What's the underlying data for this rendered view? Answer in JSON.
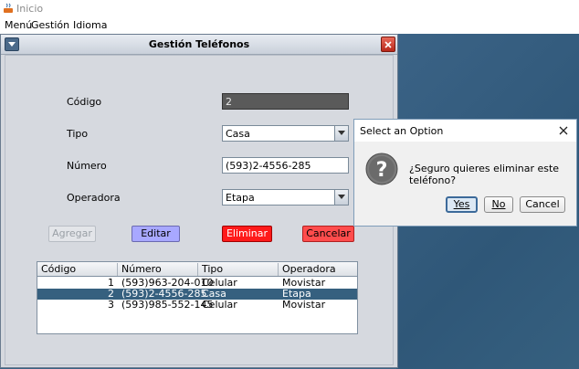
{
  "window": {
    "title": "Inicio"
  },
  "menubar": {
    "items": [
      "Menú",
      "Gestión",
      "Idioma"
    ]
  },
  "internal_frame": {
    "title": "Gestión Teléfonos",
    "form": {
      "codigo_label": "Código",
      "codigo_value": "2",
      "tipo_label": "Tipo",
      "tipo_value": "Casa",
      "numero_label": "Número",
      "numero_value": "(593)2-4556-285",
      "operadora_label": "Operadora",
      "operadora_value": "Etapa"
    },
    "buttons": {
      "agregar": "Agregar",
      "editar": "Editar",
      "eliminar": "Eliminar",
      "cancelar": "Cancelar"
    },
    "table": {
      "columns": [
        "Código",
        "Número",
        "Tipo",
        "Operadora"
      ],
      "rows": [
        {
          "codigo": "1",
          "numero": "(593)963-204-010",
          "tipo": "Celular",
          "operadora": "Movistar",
          "selected": false
        },
        {
          "codigo": "2",
          "numero": "(593)2-4556-285",
          "tipo": "Casa",
          "operadora": "Etapa",
          "selected": true
        },
        {
          "codigo": "3",
          "numero": "(593)985-552-145",
          "tipo": "Celular",
          "operadora": "Movistar",
          "selected": false
        }
      ]
    }
  },
  "dialog": {
    "title": "Select an Option",
    "message": "¿Seguro quieres eliminar este teléfono?",
    "icon": "question-icon",
    "buttons": {
      "yes": "Yes",
      "no": "No",
      "cancel": "Cancel"
    }
  },
  "colors": {
    "desktop": "#3c6384",
    "selected_row": "#36607f",
    "editar_button": "#a8a8ff",
    "eliminar_button": "#ff1a1a",
    "cancelar_button": "#ff4c4c"
  }
}
